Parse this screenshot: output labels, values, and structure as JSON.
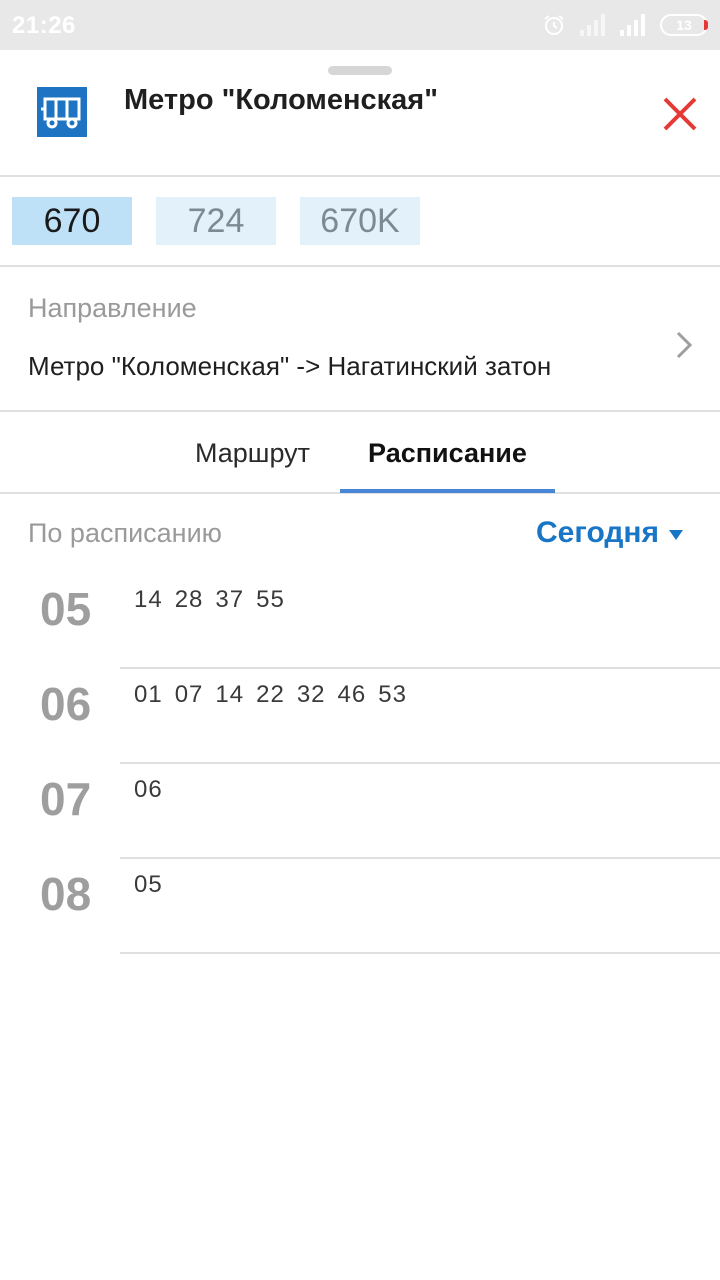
{
  "status_bar": {
    "time": "21:26",
    "battery": "13",
    "icons": [
      "alarm-icon",
      "signal-weak-icon",
      "signal-icon",
      "battery-icon"
    ]
  },
  "stop": {
    "title": "Метро \"Коломенская\"",
    "icon": "bus-icon",
    "accent_color": "#1e74c2",
    "close_color": "#e53935"
  },
  "routes": [
    {
      "label": "670",
      "active": true
    },
    {
      "label": "724",
      "active": false
    },
    {
      "label": "670K",
      "active": false
    }
  ],
  "direction": {
    "label": "Направление",
    "value": "Метро \"Коломенская\" -> Нагатинский затон"
  },
  "tabs": {
    "route": "Маршрут",
    "schedule": "Расписание",
    "active": "schedule"
  },
  "schedule": {
    "label": "По расписанию",
    "day": "Сегодня",
    "day_color": "#1976c6",
    "rows": [
      {
        "hour": "05",
        "minutes": [
          "14",
          "28",
          "37",
          "55"
        ]
      },
      {
        "hour": "06",
        "minutes": [
          "01",
          "07",
          "14",
          "22",
          "32",
          "46",
          "53"
        ]
      },
      {
        "hour": "07",
        "minutes": [
          "06"
        ]
      },
      {
        "hour": "08",
        "minutes": [
          "05"
        ]
      }
    ]
  }
}
